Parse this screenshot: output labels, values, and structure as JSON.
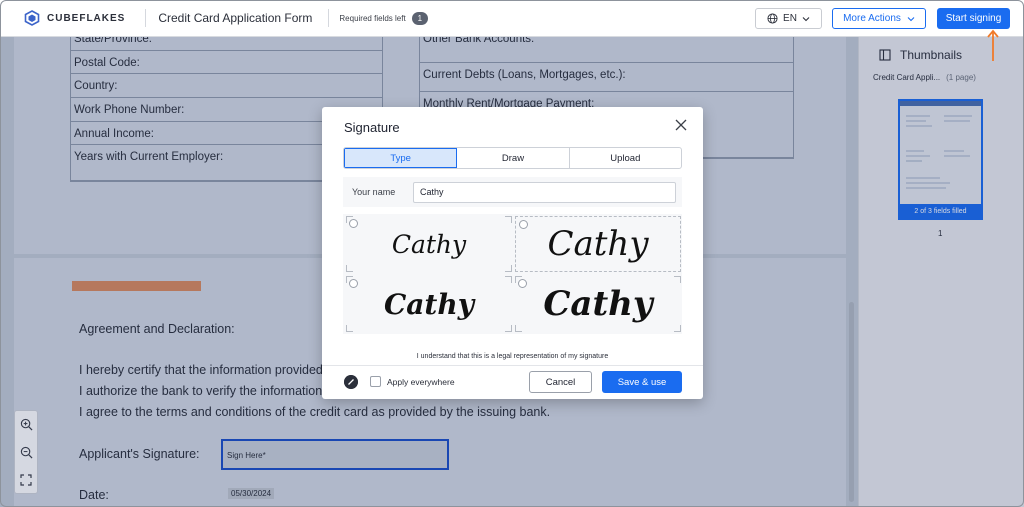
{
  "app": {
    "logo_text": "CUBEFLAKES",
    "doc_title": "Credit Card Application Form",
    "required_label": "Required fields left",
    "required_count": "1",
    "lang": "EN",
    "more_actions": "More Actions",
    "start_signing": "Start signing"
  },
  "document": {
    "left_fields": [
      "State/Province:",
      "Postal Code:",
      "Country:",
      "Work Phone Number:",
      "Annual Income:",
      "Years with Current Employer:"
    ],
    "right_fields": [
      "Other Bank Accounts:",
      "Current Debts (Loans, Mortgages, etc.):",
      "Monthly Rent/Mortgage Payment:"
    ],
    "agreement_heading": "Agreement and Declaration:",
    "certify_line": "I hereby certify that the information provided",
    "authorize_line": "I authorize the bank to verify the information p",
    "terms_line": "I agree to the terms and conditions of the credit card as provided by the issuing bank.",
    "signature_label": "Applicant's Signature:",
    "sign_here": "Sign Here*",
    "date_label": "Date:",
    "date_value": "05/30/2024"
  },
  "thumbnails": {
    "title": "Thumbnails",
    "doc_name": "Credit Card Appli...",
    "pages": "(1 page)",
    "progress": "2 of 3 fields filled",
    "page_number": "1"
  },
  "modal": {
    "title": "Signature",
    "tabs": [
      {
        "label": "Type",
        "active": true
      },
      {
        "label": "Draw",
        "active": false
      },
      {
        "label": "Upload",
        "active": false
      }
    ],
    "name_label": "Your name",
    "name_value": "Cathy",
    "signatures": [
      "Cathy",
      "Cathy",
      "Cathy",
      "Cathy"
    ],
    "selected_signature": 1,
    "legal_text": "I understand that this is a legal representation of my signature",
    "apply_everywhere": "Apply everywhere",
    "cancel": "Cancel",
    "save": "Save & use"
  },
  "colors": {
    "accent": "#1a6cf0",
    "orange_bar": "#d98a5e",
    "arrow": "#f07a2a"
  }
}
